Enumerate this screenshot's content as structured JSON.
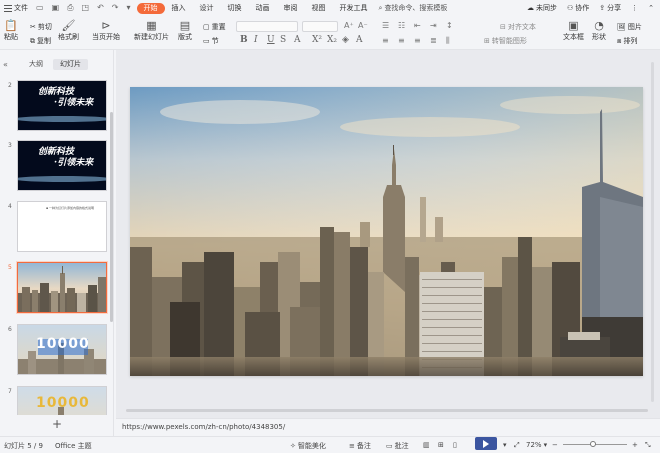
{
  "menubar": {
    "file_label": "文件",
    "tabs": [
      "开始",
      "插入",
      "设计",
      "切换",
      "动画",
      "审阅",
      "视图",
      "开发工具"
    ],
    "active_tab": "开始",
    "search_label": "查找命令、搜索模板",
    "sync_label": "未同步",
    "collab_label": "协作",
    "share_label": "分享"
  },
  "ribbon": {
    "paste": "粘贴",
    "cut": "剪切",
    "copy": "复制",
    "format_painter": "格式刷",
    "play_from_current": "当页开始",
    "new_slide": "新建幻灯片",
    "layout": "版式",
    "section": "节",
    "reset": "重置",
    "text_align": "对齐文本",
    "smart_art": "转智能图形",
    "textbox": "文本框",
    "shape": "形状",
    "picture": "图片",
    "arrange": "排列",
    "fill": "填充"
  },
  "panel": {
    "tab_outline": "大纲",
    "tab_slides": "幻灯片",
    "slides": [
      {
        "num": "2",
        "title_line1": "创新科技",
        "title_line2": "·引领未来"
      },
      {
        "num": "3",
        "title_line1": "创新科技",
        "title_line2": "·引领未来"
      },
      {
        "num": "4",
        "caption": "▪ 一种为幻灯片添加内容的格式说明"
      },
      {
        "num": "5",
        "selected": true
      },
      {
        "num": "6",
        "big_text": "10000"
      },
      {
        "num": "7",
        "big_text": "10000"
      }
    ]
  },
  "notes": {
    "text": "https://www.pexels.com/zh-cn/photo/4348305/"
  },
  "status": {
    "slide_info": "幻灯片 5 / 9",
    "theme": "Office 主题",
    "beautify": "智能美化",
    "notes": "备注",
    "comments": "批注",
    "zoom": "72%"
  },
  "colors": {
    "accent": "#f46a3a",
    "play": "#3b55a0"
  }
}
